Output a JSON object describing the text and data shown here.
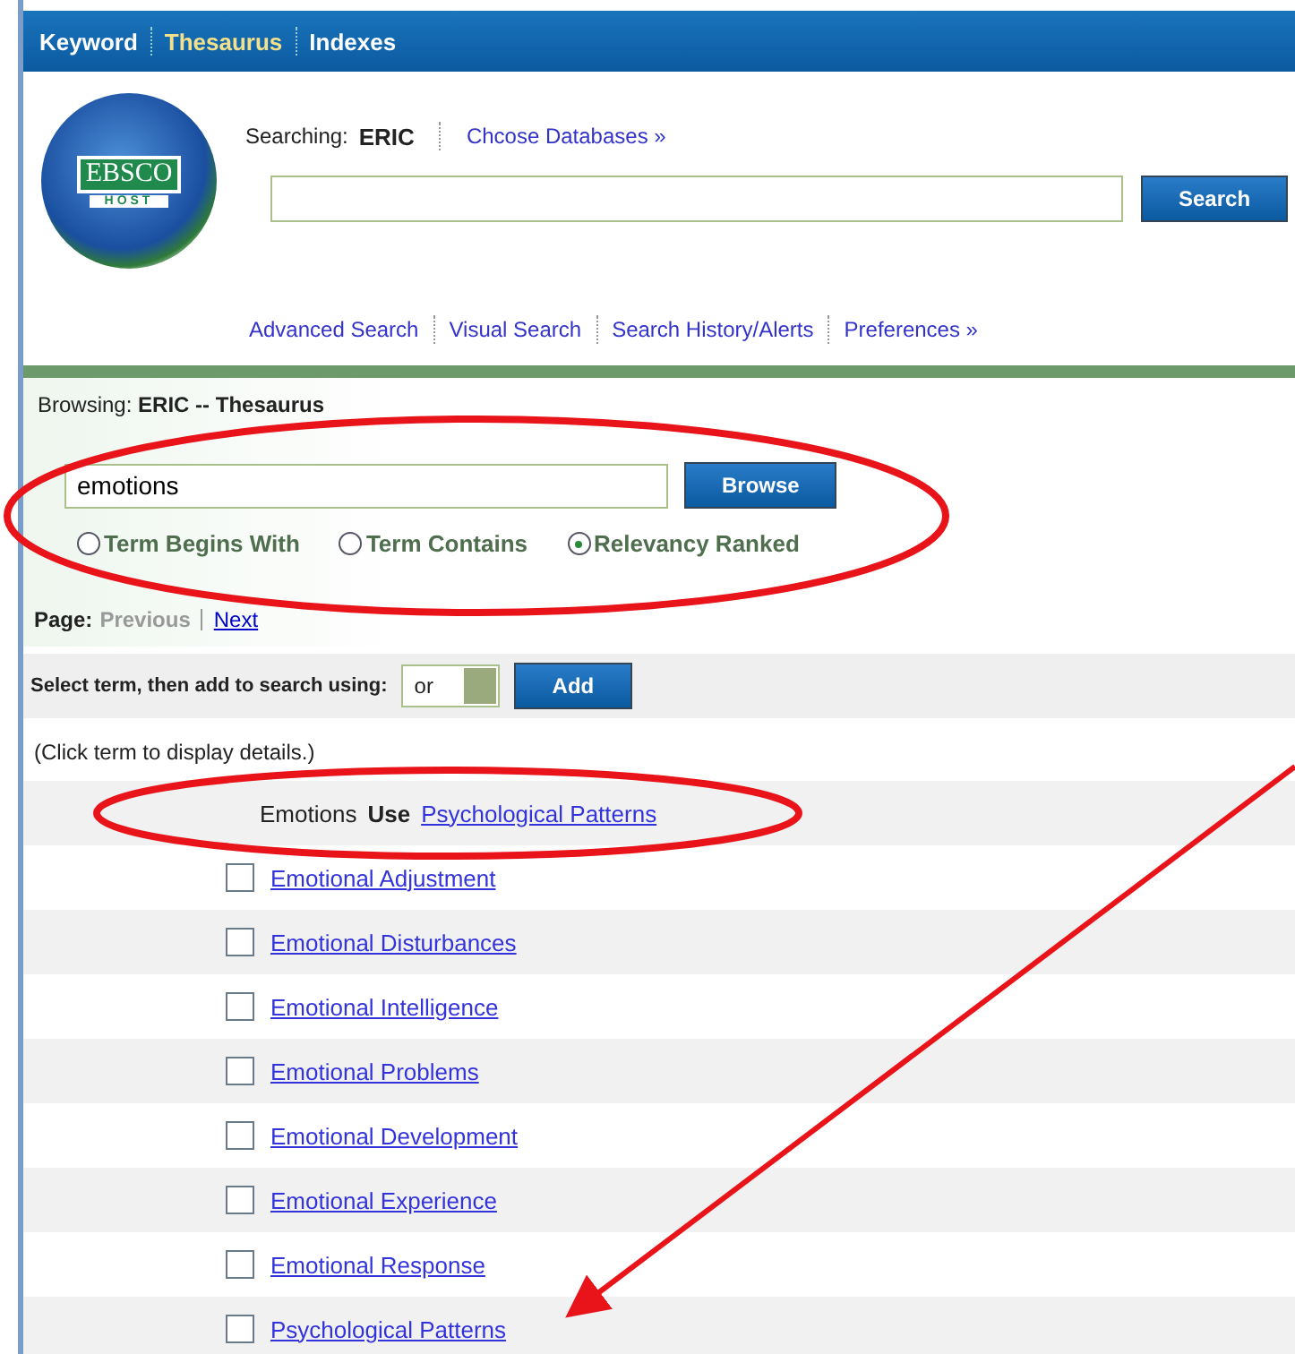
{
  "tabs": [
    {
      "label": "Keyword",
      "selected": false
    },
    {
      "label": "Thesaurus",
      "selected": true
    },
    {
      "label": "Indexes",
      "selected": false
    }
  ],
  "header": {
    "logo_text": "EBSCO",
    "logo_subtext": "HOST",
    "searching_label": "Searching:",
    "database": "ERIC",
    "choose_link": "Chcose Databases »",
    "search_button": "Search",
    "links": [
      "Advanced Search",
      "Visual Search",
      "Search History/Alerts",
      "Preferences »"
    ]
  },
  "browse": {
    "label": "Browsing:",
    "source": "ERIC -- Thesaurus",
    "value": "emotions",
    "button": "Browse",
    "options": [
      {
        "label": "Term Begins With",
        "selected": false
      },
      {
        "label": "Term Contains",
        "selected": false
      },
      {
        "label": "Relevancy Ranked",
        "selected": true
      }
    ]
  },
  "pager": {
    "label": "Page:",
    "links": [
      {
        "label": "Previous",
        "disabled": true
      },
      {
        "label": "Next",
        "disabled": false
      }
    ]
  },
  "add_bar": {
    "label": "Select term, then add to search using:",
    "operator": "or",
    "button": "Add"
  },
  "hint": "(Click term to display details.)",
  "use_row": {
    "term": "Emotions",
    "use": "Use",
    "target": "Psychological Patterns"
  },
  "terms": [
    {
      "label": "Emotional Adjustment",
      "checked": false
    },
    {
      "label": "Emotional Disturbances",
      "checked": false
    },
    {
      "label": "Emotional Intelligence",
      "checked": false
    },
    {
      "label": "Emotional Problems",
      "checked": false
    },
    {
      "label": "Emotional Development",
      "checked": false
    },
    {
      "label": "Emotional Experience",
      "checked": false
    },
    {
      "label": "Emotional Response",
      "checked": false
    },
    {
      "label": "Psychological Patterns",
      "checked": false
    }
  ]
}
